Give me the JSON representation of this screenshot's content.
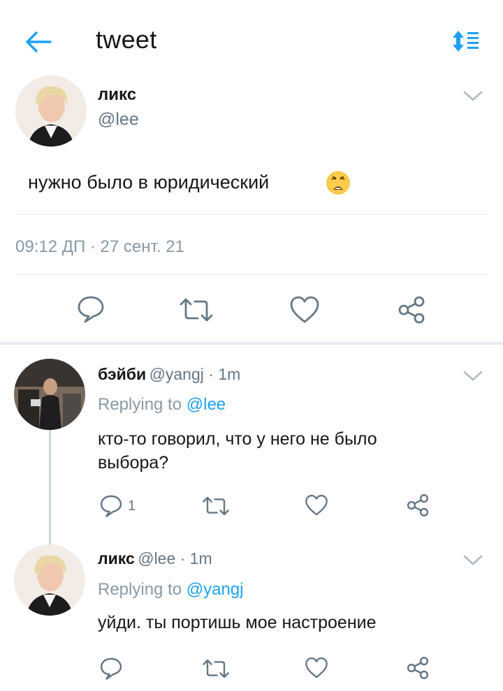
{
  "header": {
    "title": "tweet",
    "accent": "#1da1f2",
    "icons": [
      "back-arrow-icon",
      "sort-icon"
    ]
  },
  "main_tweet": {
    "name": "ликс",
    "handle": "@lee",
    "text": "нужно было в юридический",
    "emoji": "😩",
    "timestamp": "09:12 ДП · 27 сент. 21",
    "actions": [
      "reply-icon",
      "retweet-icon",
      "like-icon",
      "share-icon"
    ]
  },
  "replies": [
    {
      "name": "бэйби",
      "handle": "@yangj · 1m",
      "replying_prefix": "Replying to ",
      "replying_to": "@lee",
      "text_line1": "кто-то говорил, что у него не было",
      "text_line2": "выбора?",
      "reply_count": "1"
    },
    {
      "name": "ликс",
      "handle": "@lee · 1m",
      "replying_prefix": "Replying to ",
      "replying_to": "@yangj",
      "text_line1": "уйди. ты портишь мое настроение"
    }
  ],
  "colors": {
    "text": "#14171a",
    "secondary": "#657786",
    "link": "#1da1f2",
    "divider": "#e6ecf0"
  }
}
